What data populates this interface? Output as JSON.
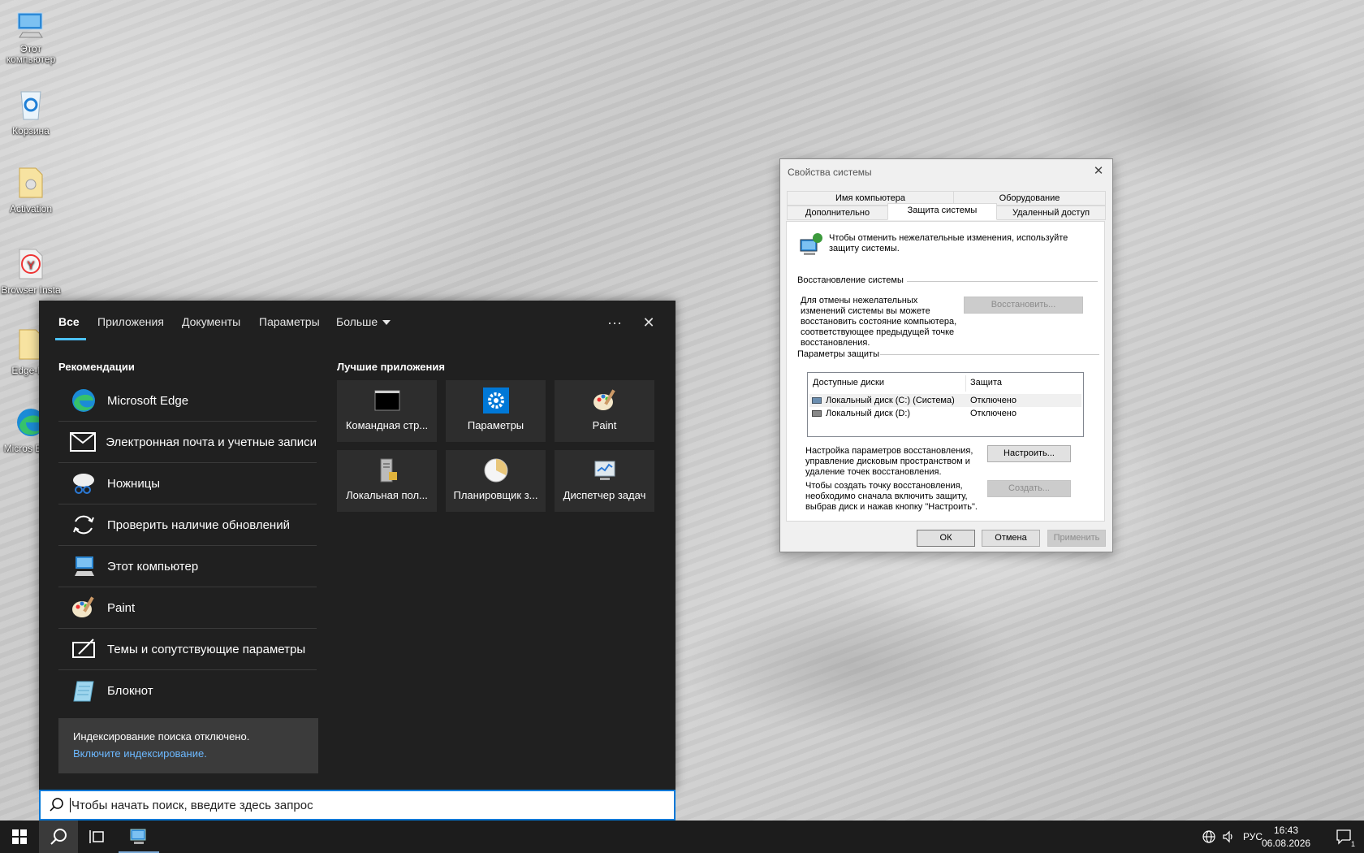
{
  "desktop": {
    "icons": [
      {
        "label": "Этот компьютер",
        "icon": "this-pc-icon"
      },
      {
        "label": "Корзина",
        "icon": "recycle-bin-icon"
      },
      {
        "label": "Activation",
        "icon": "folder-icon"
      },
      {
        "label": "Browser Insta",
        "icon": "yandex-browser-icon"
      },
      {
        "label": "Edge-Re",
        "icon": "folder-icon"
      },
      {
        "label": "Micros Edge",
        "icon": "edge-icon"
      }
    ]
  },
  "search_panel": {
    "tabs": [
      {
        "label": "Все",
        "active": true
      },
      {
        "label": "Приложения"
      },
      {
        "label": "Документы"
      },
      {
        "label": "Параметры"
      },
      {
        "label": "Больше"
      }
    ],
    "more_glyph": "···",
    "close_glyph": "✕",
    "recommendations_title": "Рекомендации",
    "recommendations": [
      {
        "label": "Microsoft Edge",
        "icon": "edge-icon"
      },
      {
        "label": "Электронная почта и учетные записи",
        "icon": "mail-icon"
      },
      {
        "label": "Ножницы",
        "icon": "scissors-icon"
      },
      {
        "label": "Проверить наличие обновлений",
        "icon": "refresh-icon"
      },
      {
        "label": "Этот компьютер",
        "icon": "this-pc-icon"
      },
      {
        "label": "Paint",
        "icon": "paint-icon"
      },
      {
        "label": "Темы и сопутствующие параметры",
        "icon": "themes-icon"
      },
      {
        "label": "Блокнот",
        "icon": "notepad-icon"
      }
    ],
    "best_apps_title": "Лучшие приложения",
    "best_apps": [
      {
        "label": "Командная стр...",
        "icon": "cmd-icon"
      },
      {
        "label": "Параметры",
        "icon": "gear-icon"
      },
      {
        "label": "Paint",
        "icon": "paint-icon"
      },
      {
        "label": "Локальная пол...",
        "icon": "security-policy-icon"
      },
      {
        "label": "Планировщик з...",
        "icon": "scheduler-icon"
      },
      {
        "label": "Диспетчер задач",
        "icon": "task-manager-icon"
      }
    ],
    "indexing": {
      "text": "Индексирование поиска отключено.",
      "link": "Включите индексирование."
    }
  },
  "search_box": {
    "placeholder": "Чтобы начать поиск, введите здесь запрос"
  },
  "taskbar": {
    "language": "РУС",
    "time": "16:43",
    "date": "06.08.2026",
    "notification_count": "1"
  },
  "system_properties": {
    "title": "Свойства системы",
    "tabs_top": [
      "Имя компьютера",
      "Оборудование"
    ],
    "tabs_bottom": [
      "Дополнительно",
      "Защита системы",
      "Удаленный доступ"
    ],
    "selected_tab": "Защита системы",
    "intro": "Чтобы отменить нежелательные изменения, используйте защиту системы.",
    "restore_group": "Восстановление системы",
    "restore_text": "Для отмены нежелательных изменений системы вы можете восстановить состояние компьютера, соответствующее предыдущей точке восстановления.",
    "restore_button": "Восстановить...",
    "protection_group": "Параметры защиты",
    "columns": [
      "Доступные диски",
      "Защита"
    ],
    "drives": [
      {
        "name": "Локальный диск (C:) (Система)",
        "protection": "Отключено",
        "selected": true
      },
      {
        "name": "Локальный диск (D:)",
        "protection": "Отключено"
      }
    ],
    "configure_text": "Настройка параметров восстановления, управление дисковым пространством и удаление точек восстановления.",
    "configure_button": "Настроить...",
    "create_text": "Чтобы создать точку восстановления, необходимо сначала включить защиту, выбрав диск и нажав кнопку \"Настроить\".",
    "create_button": "Создать...",
    "ok": "ОК",
    "cancel": "Отмена",
    "apply": "Применить"
  }
}
